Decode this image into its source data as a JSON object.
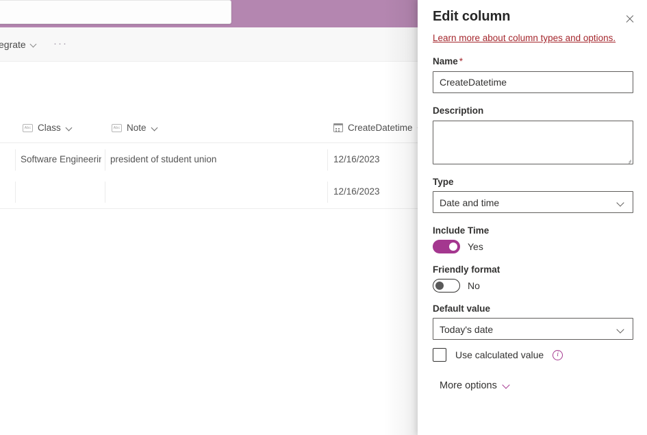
{
  "background": {
    "search": {
      "value": "",
      "placeholder": ""
    },
    "command_bar": {
      "integrate_label": "egrate",
      "overflow_label": "···"
    },
    "list": {
      "columns": [
        {
          "label": "Class",
          "icon": "abc-icon"
        },
        {
          "label": "Note",
          "icon": "abc-icon"
        },
        {
          "label": "CreateDatetime",
          "icon": "calendar-icon"
        }
      ],
      "rows": [
        {
          "class": "Software Engineering",
          "note": "president of student union",
          "create_datetime": "12/16/2023"
        },
        {
          "class": "",
          "note": "",
          "create_datetime": "12/16/2023"
        }
      ]
    }
  },
  "panel": {
    "title": "Edit column",
    "close_icon": "close-icon",
    "learn_more_link": "Learn more about column types and options.",
    "name": {
      "label": "Name",
      "required_marker": "*",
      "value": "CreateDatetime"
    },
    "description": {
      "label": "Description",
      "value": "",
      "placeholder": ""
    },
    "type": {
      "label": "Type",
      "value": "Date and time"
    },
    "include_time": {
      "label": "Include Time",
      "state": "Yes",
      "on": true
    },
    "friendly_format": {
      "label": "Friendly format",
      "state": "No",
      "on": false
    },
    "default_value": {
      "label": "Default value",
      "value": "Today's date"
    },
    "use_calculated_value": {
      "label": "Use calculated value",
      "checked": false,
      "info_icon": "info-icon"
    },
    "more_options": {
      "label": "More options",
      "chevron_icon": "chevron-down-icon"
    }
  },
  "colors": {
    "brand_band": "#b486b0",
    "accent": "#a4378f",
    "link": "#a4262c",
    "border": "#605e5c"
  }
}
